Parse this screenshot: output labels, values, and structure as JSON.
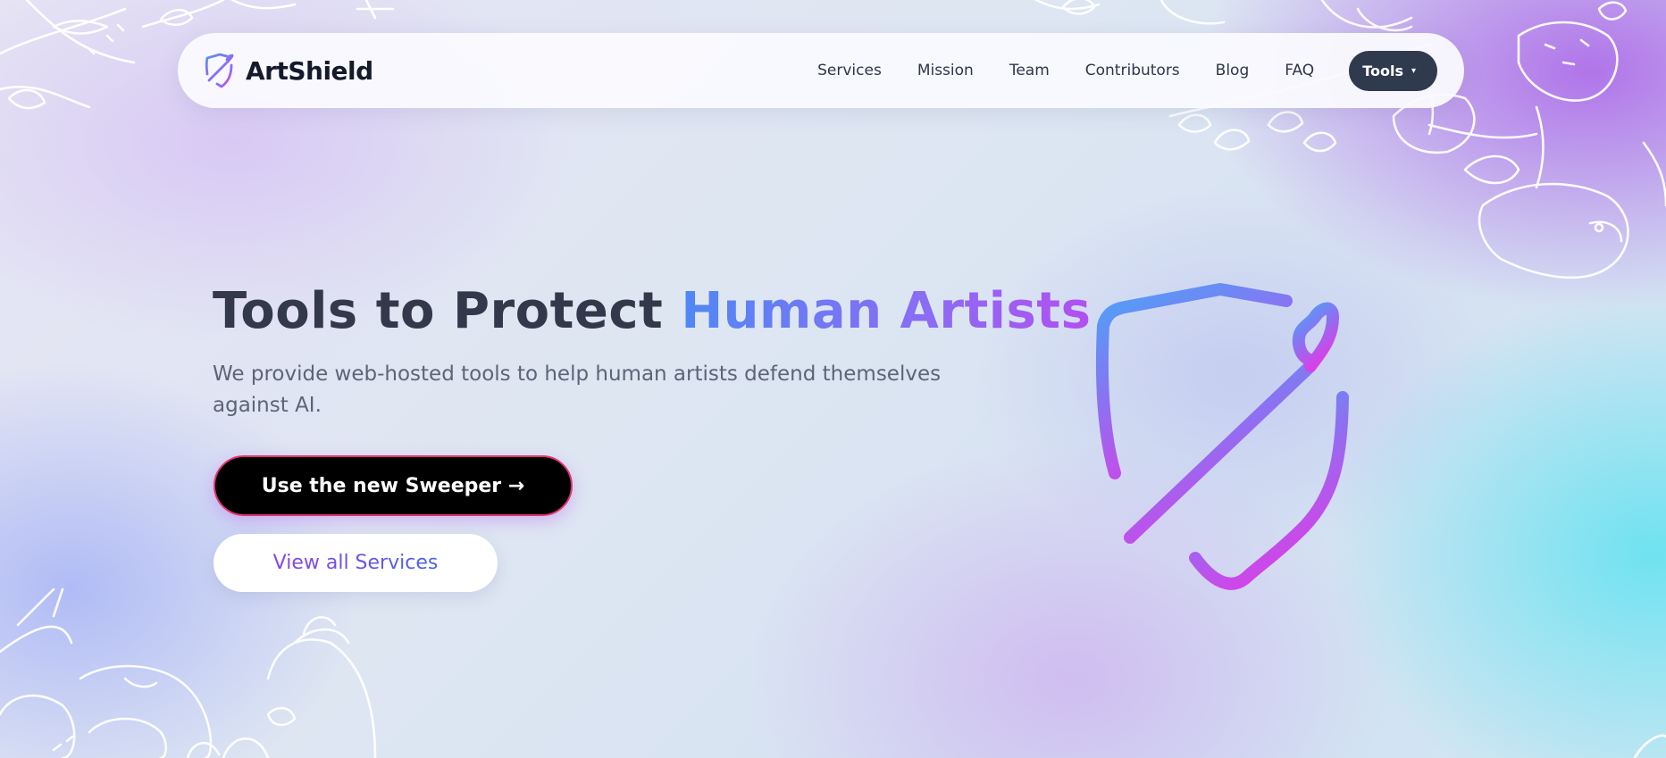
{
  "brand": {
    "name": "ArtShield",
    "logo_icon": "shield-paintbrush-icon"
  },
  "nav": {
    "links": [
      "Services",
      "Mission",
      "Team",
      "Contributors",
      "Blog",
      "FAQ"
    ],
    "tools_label": "Tools",
    "tools_caret": "▾"
  },
  "hero": {
    "title_plain": "Tools to Protect ",
    "title_highlight": "Human Artists",
    "subtitle": "We provide web-hosted tools to help human artists defend themselves against AI.",
    "primary_button": "Use the new Sweeper →",
    "secondary_button": "View all Services",
    "illustration_icon": "shield-paintbrush-icon"
  },
  "colors": {
    "gradient_start": "#4f88f5",
    "gradient_mid": "#8b6cf4",
    "gradient_end": "#e040e8",
    "nav_button_bg": "#2f3a4f",
    "primary_button_bg": "#000000",
    "primary_button_border": "#e0336f"
  }
}
